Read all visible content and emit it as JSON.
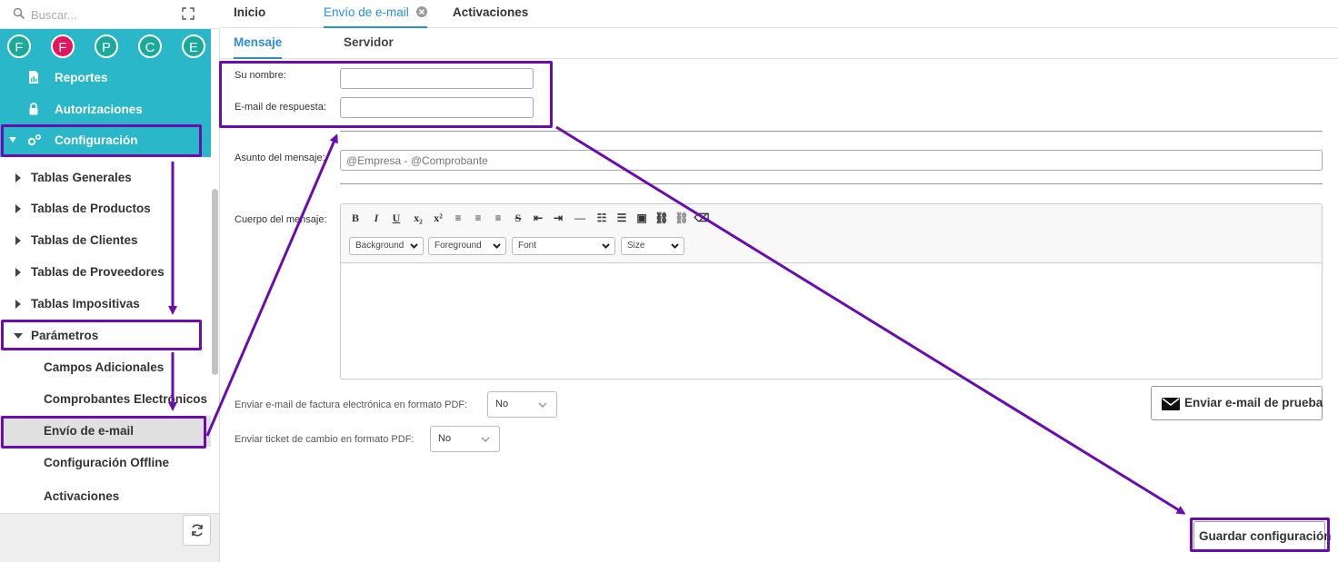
{
  "sidebar": {
    "search_placeholder": "Buscar...",
    "avatars": [
      {
        "letter": "F",
        "color": "#1aa99a"
      },
      {
        "letter": "F",
        "color": "#e6145f"
      },
      {
        "letter": "P",
        "color": "#1aa99a"
      },
      {
        "letter": "C",
        "color": "#1aa99a"
      },
      {
        "letter": "E",
        "color": "#1aa99a"
      }
    ],
    "menu": {
      "reportes": "Reportes",
      "autorizaciones": "Autorizaciones",
      "configuracion": "Configuración"
    },
    "tree": {
      "tablas_generales": "Tablas Generales",
      "tablas_productos": "Tablas de Productos",
      "tablas_clientes": "Tablas de Clientes",
      "tablas_proveedores": "Tablas de Proveedores",
      "tablas_impositivas": "Tablas Impositivas",
      "parametros": "Parámetros"
    },
    "sub": {
      "campos_adicionales": "Campos Adicionales",
      "comprobantes_electronicos": "Comprobantes Electrónicos",
      "envio_email": "Envío de e-mail",
      "configuracion_offline": "Configuración Offline",
      "activaciones": "Activaciones"
    }
  },
  "tabs": {
    "inicio": "Inicio",
    "envio_email": "Envío de e-mail",
    "activaciones": "Activaciones"
  },
  "subtabs": {
    "mensaje": "Mensaje",
    "servidor": "Servidor"
  },
  "form": {
    "su_nombre_label": "Su nombre:",
    "su_nombre_value": "",
    "email_respuesta_label": "E-mail de respuesta:",
    "email_respuesta_value": "",
    "asunto_label": "Asunto del mensaje:",
    "asunto_placeholder": "@Empresa - @Comprobante",
    "cuerpo_label": "Cuerpo del mensaje:",
    "enviar_pdf_label": "Enviar e-mail de factura electrónica en formato PDF:",
    "enviar_pdf_value": "No",
    "ticket_label": "Enviar ticket de cambio en formato PDF:",
    "ticket_value": "No"
  },
  "editor": {
    "toolbar": [
      "B",
      "I",
      "U",
      "x₂",
      "x²",
      "≡",
      "≡",
      "≡",
      "S",
      "⇤",
      "⇥",
      "—",
      "☷",
      "☰",
      "▣",
      "⛓",
      "⛓",
      "⌫"
    ],
    "selects": {
      "background": "Background",
      "foreground": "Foreground",
      "font": "Font",
      "size": "Size"
    }
  },
  "buttons": {
    "test_email": "Enviar e-mail de prueba",
    "save": "Guardar configuración"
  },
  "colors": {
    "sidebar_accent": "#29b7c9",
    "active_tab": "#2a8fd8",
    "highlight": "#6a0dad"
  }
}
